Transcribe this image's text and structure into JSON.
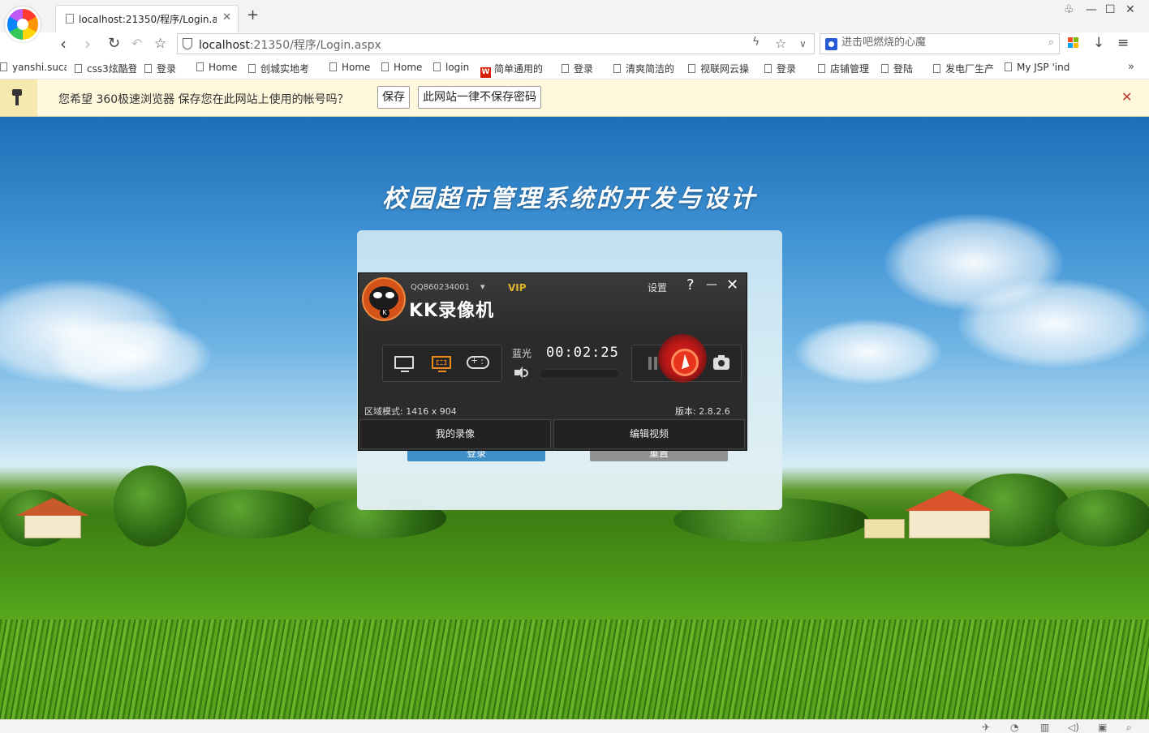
{
  "browser": {
    "tab_title": "localhost:21350/程序/Login.as",
    "address_host": "localhost",
    "address_rest": ":21350/程序/Login.aspx",
    "search_placeholder": "进击吧燃烧的心魔",
    "apps_colors": [
      "#f25022",
      "#7fba00",
      "#00a4ef",
      "#ffb900"
    ]
  },
  "bookmarks": [
    {
      "label": "yanshi.suca",
      "icon": "doc"
    },
    {
      "label": "css3炫酷登",
      "icon": "doc"
    },
    {
      "label": "登录",
      "icon": "doc"
    },
    {
      "label": "Home",
      "icon": "doc"
    },
    {
      "label": "创城实地考",
      "icon": "doc"
    },
    {
      "label": "Home",
      "icon": "doc"
    },
    {
      "label": "Home",
      "icon": "doc"
    },
    {
      "label": "login",
      "icon": "doc"
    },
    {
      "label": "简单通用的",
      "icon": "red-logo"
    },
    {
      "label": "登录",
      "icon": "doc"
    },
    {
      "label": "清爽简洁的",
      "icon": "doc"
    },
    {
      "label": "视联网云操",
      "icon": "doc"
    },
    {
      "label": "登录",
      "icon": "doc"
    },
    {
      "label": "店铺管理",
      "icon": "doc"
    },
    {
      "label": "登陆",
      "icon": "doc"
    },
    {
      "label": "发电厂生产",
      "icon": "doc"
    },
    {
      "label": "My JSP 'ind",
      "icon": "doc"
    }
  ],
  "infobar": {
    "message": "您希望 360极速浏览器 保存您在此网站上使用的帐号吗？",
    "save_label": "保存",
    "never_label": "此网站一律不保存密码"
  },
  "page": {
    "title": "校园超市管理系统的开发与设计",
    "login_label": "登录",
    "reset_label": "重置",
    "login_color": "#3a8cc8",
    "reset_color": "#8e8e8e"
  },
  "recorder": {
    "user": "QQ860234001",
    "vip": "VIP",
    "brand": "KK录像机",
    "settings": "设置",
    "help": "?",
    "minimize": "—",
    "close": "✕",
    "quality": "蓝光",
    "timer": "00:02:25",
    "region": "区域模式: 1416 x 904",
    "version": "版本: 2.8.2.6",
    "my_videos": "我的录像",
    "edit_video": "编辑视频",
    "logo_badge": "K",
    "active_mode": "area",
    "accent_color": "#f08a1c",
    "record_color": "#e8341c"
  }
}
